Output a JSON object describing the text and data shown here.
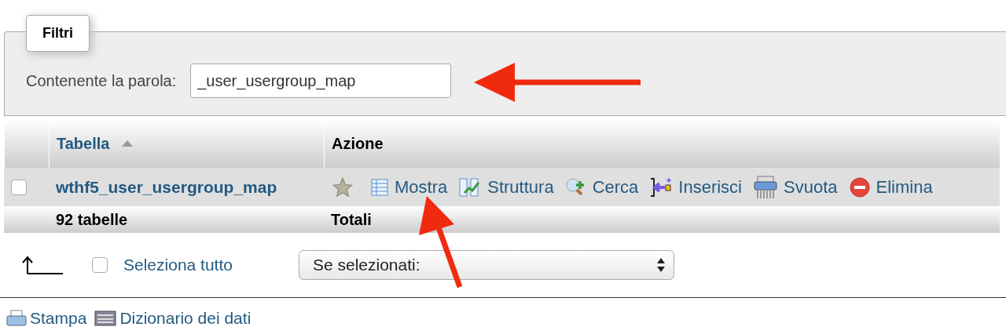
{
  "filter": {
    "legend": "Filtri",
    "label": "Contenente la parola:",
    "value": "_user_usergroup_map",
    "arrow": true
  },
  "table": {
    "columns": [
      {
        "label": "Tabella",
        "sorted": true
      },
      {
        "label": "Azione",
        "sorted": false
      }
    ],
    "rows": [
      {
        "checked": false,
        "name": "wthf5_user_usergroup_map",
        "actions": [
          {
            "kind": "favorite"
          },
          {
            "kind": "browse",
            "label": "Mostra",
            "arrow": true
          },
          {
            "kind": "structure",
            "label": "Struttura"
          },
          {
            "kind": "search",
            "label": "Cerca"
          },
          {
            "kind": "insert",
            "label": "Inserisci"
          },
          {
            "kind": "empty",
            "label": "Svuota"
          },
          {
            "kind": "drop",
            "label": "Elimina"
          }
        ]
      }
    ],
    "footer": {
      "count": "92 tabelle",
      "label": "Totali"
    }
  },
  "bulk": {
    "select_all": {
      "label": "Seleziona tutto",
      "checked": false
    },
    "select": {
      "value": "Se selezionati:"
    }
  },
  "links": [
    {
      "kind": "print",
      "label": "Stampa"
    },
    {
      "kind": "dictionary",
      "label": "Dizionario dei dati"
    }
  ]
}
